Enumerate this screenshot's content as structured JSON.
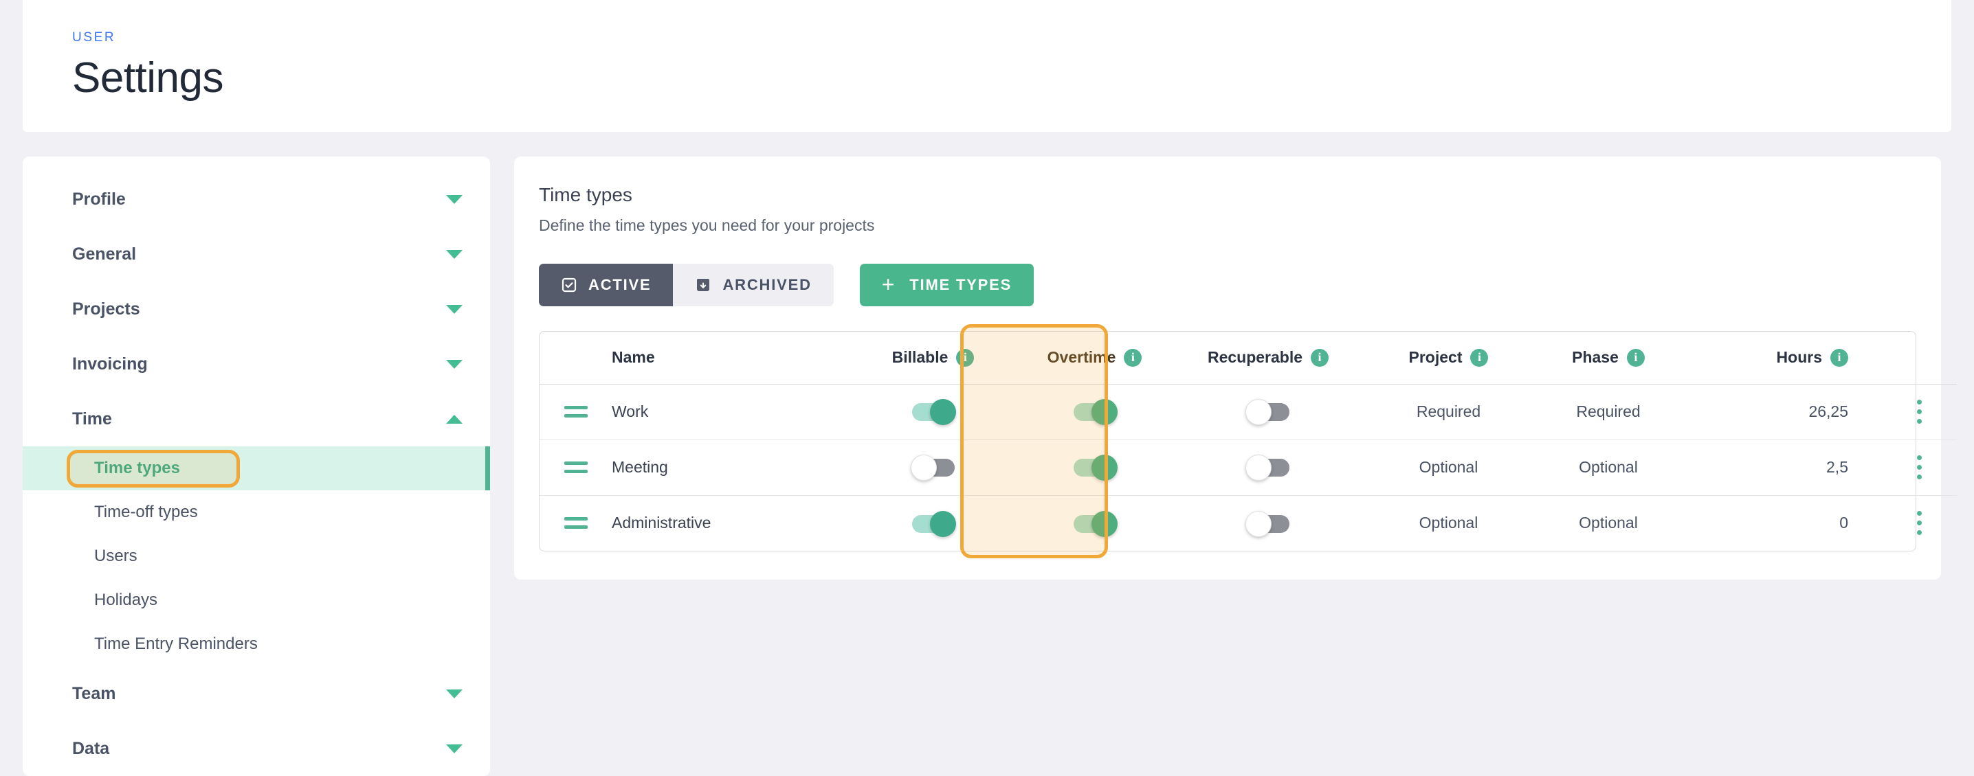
{
  "header": {
    "eyebrow": "USER",
    "title": "Settings"
  },
  "sidebar": {
    "groups": [
      {
        "label": "Profile",
        "icon": "chevron-down-icon",
        "expanded": false
      },
      {
        "label": "General",
        "icon": "chevron-down-icon",
        "expanded": false
      },
      {
        "label": "Projects",
        "icon": "chevron-down-icon",
        "expanded": false
      },
      {
        "label": "Invoicing",
        "icon": "chevron-down-icon",
        "expanded": false
      },
      {
        "label": "Time",
        "icon": "chevron-up-icon",
        "expanded": true
      },
      {
        "label": "Team",
        "icon": "chevron-down-icon",
        "expanded": false
      },
      {
        "label": "Data",
        "icon": "chevron-down-icon",
        "expanded": false
      }
    ],
    "time_items": [
      {
        "label": "Time types",
        "active": true
      },
      {
        "label": "Time-off types",
        "active": false
      },
      {
        "label": "Users",
        "active": false
      },
      {
        "label": "Holidays",
        "active": false
      },
      {
        "label": "Time Entry Reminders",
        "active": false
      }
    ]
  },
  "main": {
    "title": "Time types",
    "subtitle": "Define the time types you need for your projects",
    "filters": [
      {
        "label": "ACTIVE",
        "icon": "checkbox-checked-icon",
        "selected": true
      },
      {
        "label": "ARCHIVED",
        "icon": "archive-box-icon",
        "selected": false
      }
    ],
    "add_button": {
      "label": "TIME TYPES",
      "icon": "plus-icon"
    },
    "table": {
      "columns": [
        {
          "key": "handle",
          "label": "",
          "info": false
        },
        {
          "key": "name",
          "label": "Name",
          "info": false
        },
        {
          "key": "billable",
          "label": "Billable",
          "info": true
        },
        {
          "key": "overtime",
          "label": "Overtime",
          "info": true
        },
        {
          "key": "recuperable",
          "label": "Recuperable",
          "info": true
        },
        {
          "key": "project",
          "label": "Project",
          "info": true
        },
        {
          "key": "phase",
          "label": "Phase",
          "info": true
        },
        {
          "key": "hours",
          "label": "Hours",
          "info": true
        },
        {
          "key": "menu",
          "label": "",
          "info": false
        }
      ],
      "rows": [
        {
          "name": "Work",
          "billable": true,
          "overtime": true,
          "recuperable": false,
          "project": "Required",
          "phase": "Required",
          "hours": "26,25"
        },
        {
          "name": "Meeting",
          "billable": false,
          "overtime": true,
          "recuperable": false,
          "project": "Optional",
          "phase": "Optional",
          "hours": "2,5"
        },
        {
          "name": "Administrative",
          "billable": true,
          "overtime": true,
          "recuperable": false,
          "project": "Optional",
          "phase": "Optional",
          "hours": "0"
        }
      ]
    }
  },
  "annotations": {
    "sidebar_highlight": "Time types",
    "column_highlight": "Overtime",
    "color": "#f0a838"
  },
  "colors": {
    "accent_green": "#49b68d",
    "toggle_on": "#4fae7f",
    "eyebrow_blue": "#3f74f0",
    "dark_chip": "#555b6b",
    "page_bg": "#f1f1f5"
  }
}
